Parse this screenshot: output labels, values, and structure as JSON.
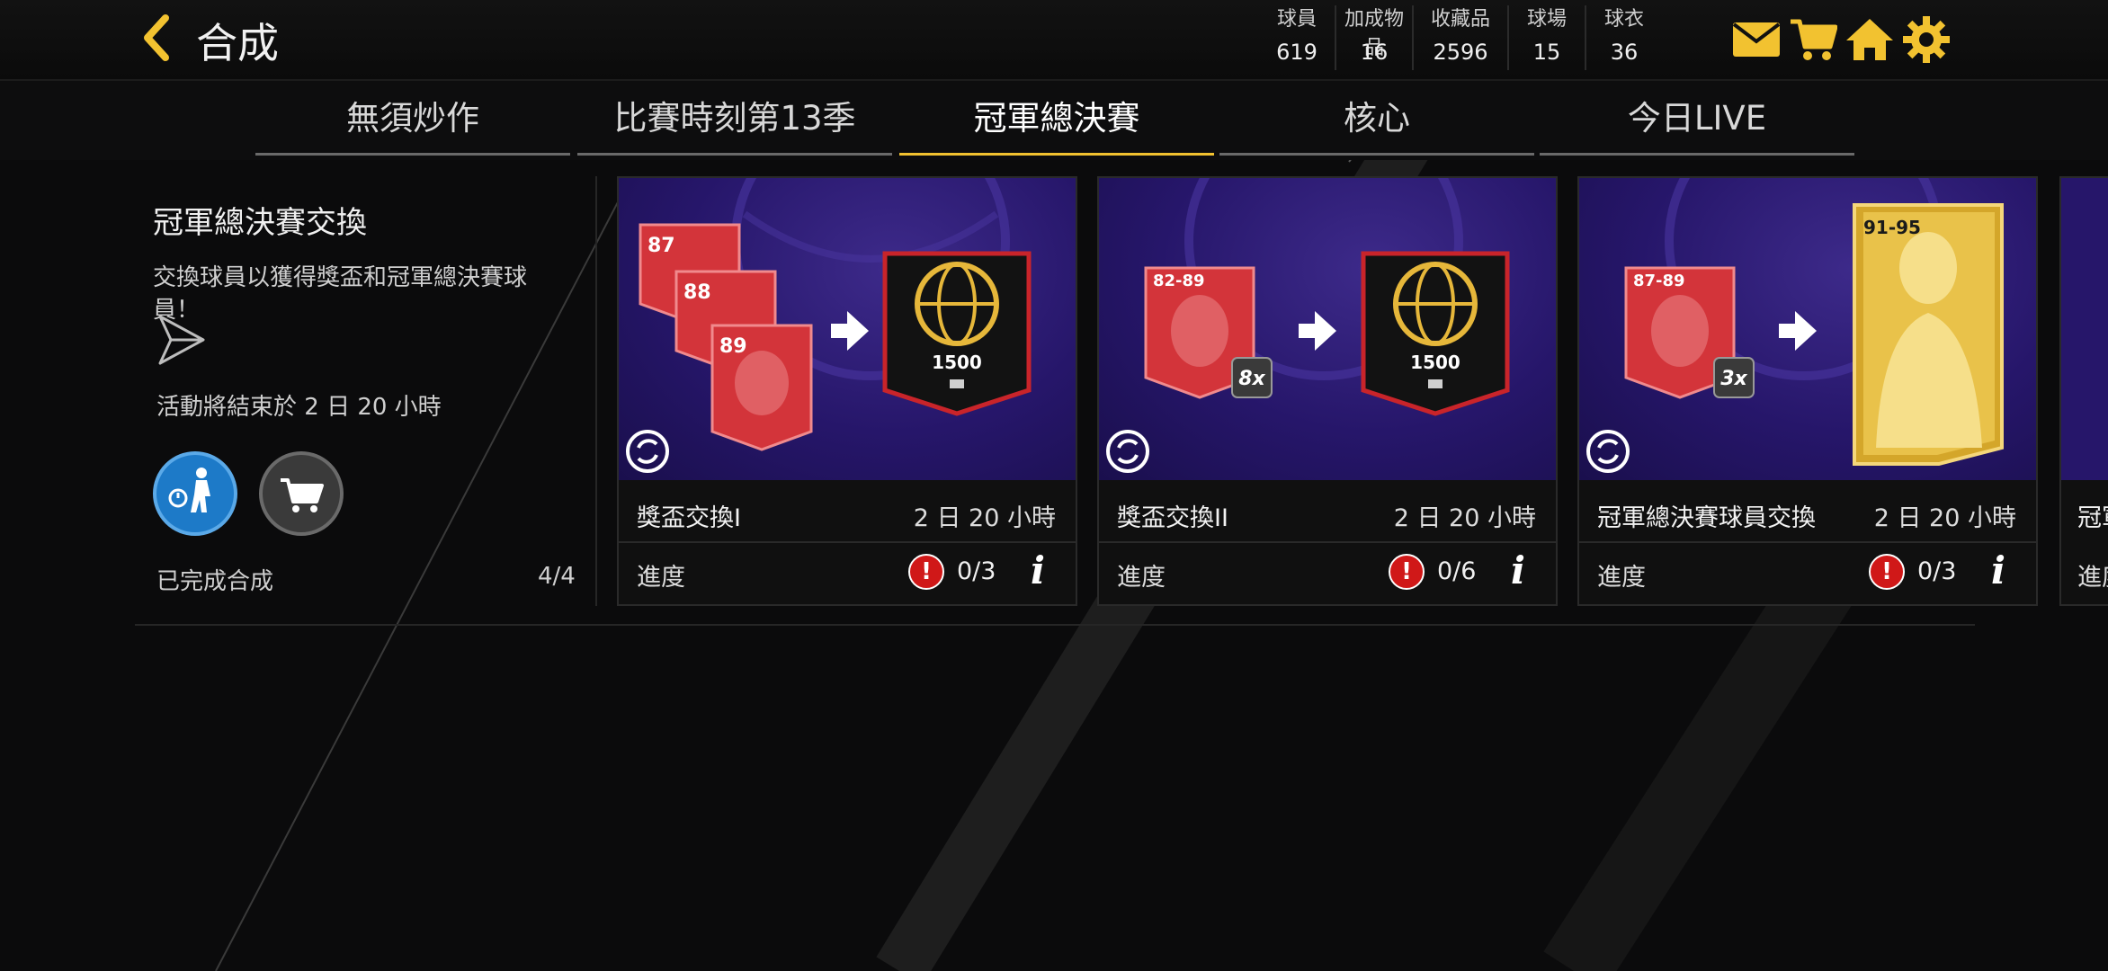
{
  "header": {
    "title": "合成",
    "stats": [
      {
        "label": "球員",
        "value": "619"
      },
      {
        "label": "加成物品",
        "value": "16"
      },
      {
        "label": "收藏品",
        "value": "2596"
      },
      {
        "label": "球場",
        "value": "15"
      },
      {
        "label": "球衣",
        "value": "36"
      }
    ],
    "icons": [
      "mail-icon",
      "cart-icon",
      "home-icon",
      "settings-gear-icon"
    ],
    "accent_color": "#f2c230"
  },
  "tabs": [
    {
      "label": "無須炒作"
    },
    {
      "label": "比賽時刻第13季"
    },
    {
      "label": "冠軍總決賽",
      "active": true
    },
    {
      "label": "核心"
    },
    {
      "label": "今日LIVE"
    }
  ],
  "left_panel": {
    "title": "冠軍總決賽交換",
    "description": "交換球員以獲得獎盃和冠軍總決賽球員！",
    "ends_text": "活動將結束於  2 日 20 小時",
    "completed_label": "已完成合成",
    "completed_count": "4/4"
  },
  "cards": [
    {
      "name": "獎盃交換I",
      "time": "2 日 20 小時",
      "progress_label": "進度",
      "progress": "0/3",
      "inputs": [
        "87",
        "88",
        "89"
      ],
      "reward_value": "1500"
    },
    {
      "name": "獎盃交換II",
      "time": "2 日 20 小時",
      "progress_label": "進度",
      "progress": "0/6",
      "input_range": "82-89",
      "multiplier": "8x",
      "reward_value": "1500"
    },
    {
      "name": "冠軍總決賽球員交換",
      "time": "2 日 20 小時",
      "progress_label": "進度",
      "progress": "0/3",
      "input_range": "87-89",
      "multiplier": "3x",
      "reward_range": "91-95"
    }
  ],
  "partial_card": {
    "name": "冠軍",
    "progress_label": "進度"
  }
}
